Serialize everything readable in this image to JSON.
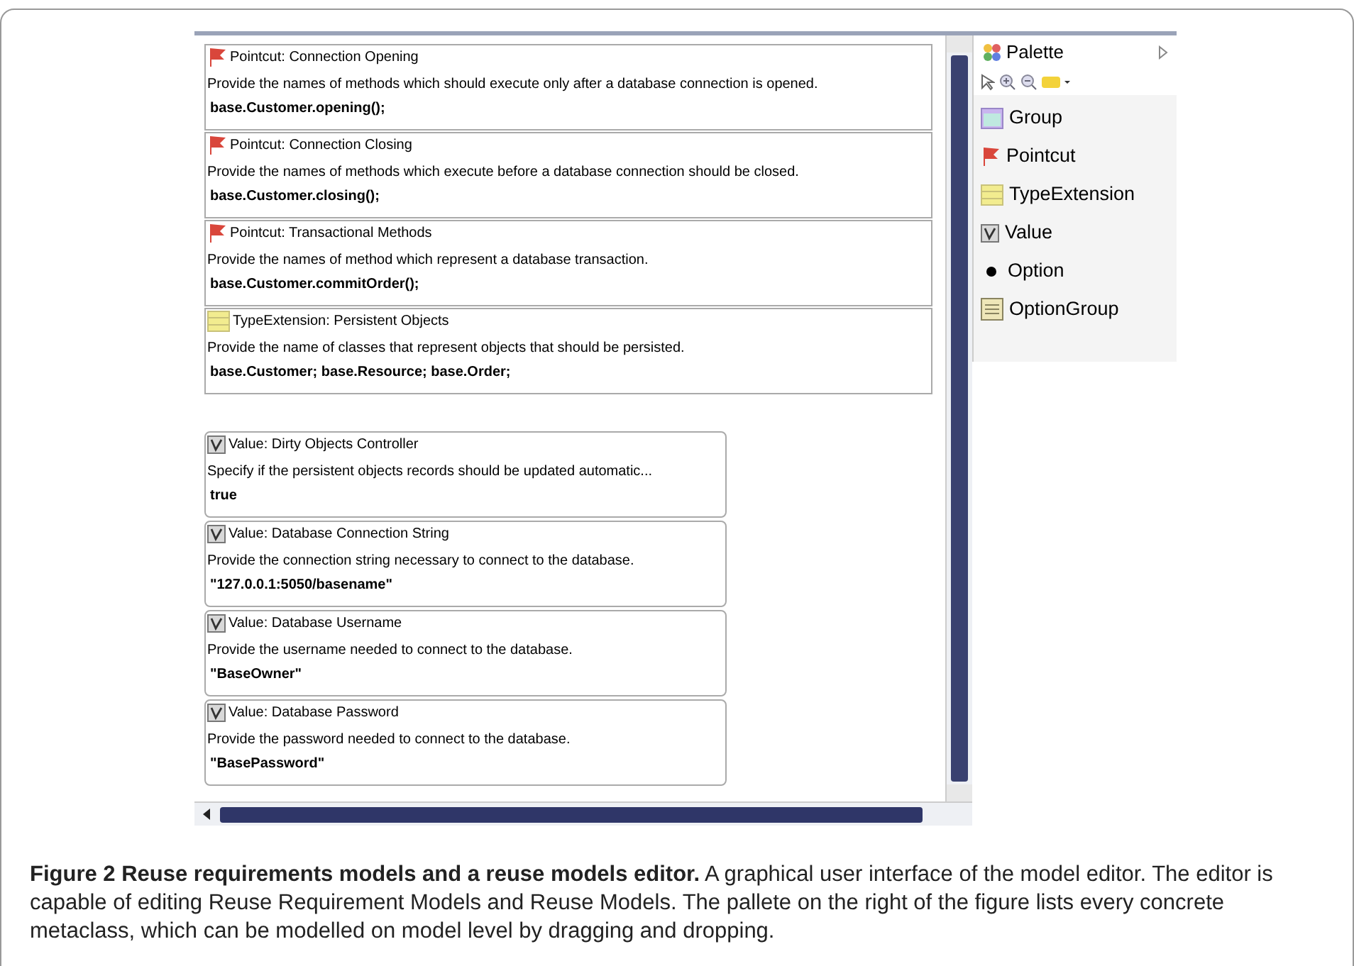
{
  "editor": {
    "nodes": [
      {
        "kind": "pointcut",
        "title": "Pointcut: Connection Opening",
        "description": "Provide the names of methods which should execute only after a database connection is opened.",
        "value": "base.Customer.opening();"
      },
      {
        "kind": "pointcut",
        "title": "Pointcut: Connection Closing",
        "description": "Provide the names of methods which execute before a database connection should be closed.",
        "value": "base.Customer.closing();"
      },
      {
        "kind": "pointcut",
        "title": "Pointcut: Transactional Methods",
        "description": "Provide the names of method which represent a database transaction.",
        "value": "base.Customer.commitOrder();"
      },
      {
        "kind": "typeextension",
        "title": "TypeExtension: Persistent Objects",
        "description": "Provide the name of classes that represent objects that should be persisted.",
        "value": "base.Customer; base.Resource; base.Order;"
      }
    ],
    "value_nodes": [
      {
        "kind": "value",
        "title": "Value: Dirty Objects Controller",
        "description": "Specify if the persistent objects records should be updated automatic...",
        "value": "true"
      },
      {
        "kind": "value",
        "title": "Value: Database Connection String",
        "description": "Provide the connection string necessary to connect to the database.",
        "value": "\"127.0.0.1:5050/basename\""
      },
      {
        "kind": "value",
        "title": "Value: Database Username",
        "description": "Provide the username needed to connect to the database.",
        "value": "\"BaseOwner\""
      },
      {
        "kind": "value",
        "title": "Value: Database Password",
        "description": "Provide the password needed to connect to the database.",
        "value": "\"BasePassword\""
      }
    ]
  },
  "palette": {
    "title": "Palette",
    "items": [
      {
        "kind": "group",
        "label": "Group"
      },
      {
        "kind": "pointcut",
        "label": "Pointcut"
      },
      {
        "kind": "typeextension",
        "label": "TypeExtension"
      },
      {
        "kind": "value",
        "label": "Value"
      },
      {
        "kind": "option",
        "label": "Option"
      },
      {
        "kind": "optiongroup",
        "label": "OptionGroup"
      }
    ]
  },
  "caption": "**Figure 2 Reuse requirements models and a reuse models editor.** A graphical user interface of the model editor. The editor is capable of editing Reuse Requirement Models and Reuse Models. The pallete on the right of the figure lists every concrete metaclass, which can be modelled on model level by dragging and dropping."
}
